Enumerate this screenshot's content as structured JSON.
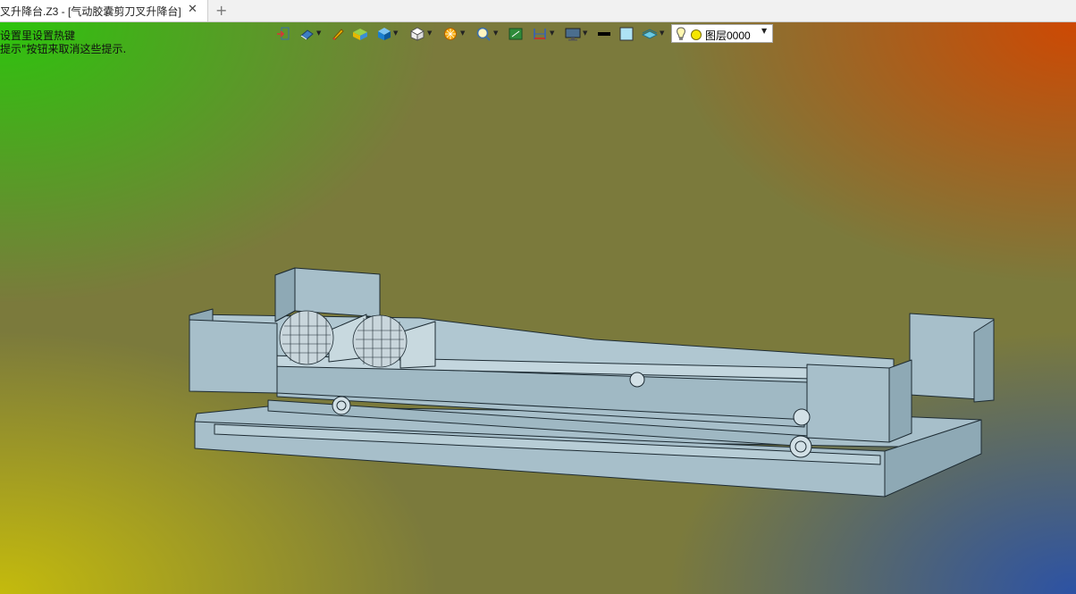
{
  "tab": {
    "label": "叉升降台.Z3 - [气动胶囊剪刀叉升降台]",
    "close_icon": "close-icon",
    "add_icon": "plus-icon"
  },
  "hints": {
    "line1": "设置里设置热键",
    "line2": "提示\"按钮来取消这些提示."
  },
  "toolbar": {
    "icons": [
      "exit-icon",
      "render-mode-icon",
      "pencil-icon",
      "box-color-icon",
      "cube-icon",
      "view-cube-icon",
      "filter-icon",
      "zoom-icon",
      "fit-icon",
      "dimension-icon",
      "display-icon",
      "color-black-icon",
      "color-fill-icon",
      "layer-plane-icon"
    ]
  },
  "layer": {
    "label": "图层0000",
    "bulb_icon": "light-bulb-icon",
    "status_icon": "layer-status-icon"
  },
  "colors": {
    "model_face": "#a7bfca",
    "model_edge": "#1d2b33",
    "corner_top_left": "#28c80a",
    "corner_top_right": "#d24600",
    "corner_bottom_left": "#c8be0a",
    "corner_bottom_right": "#2850aa"
  }
}
